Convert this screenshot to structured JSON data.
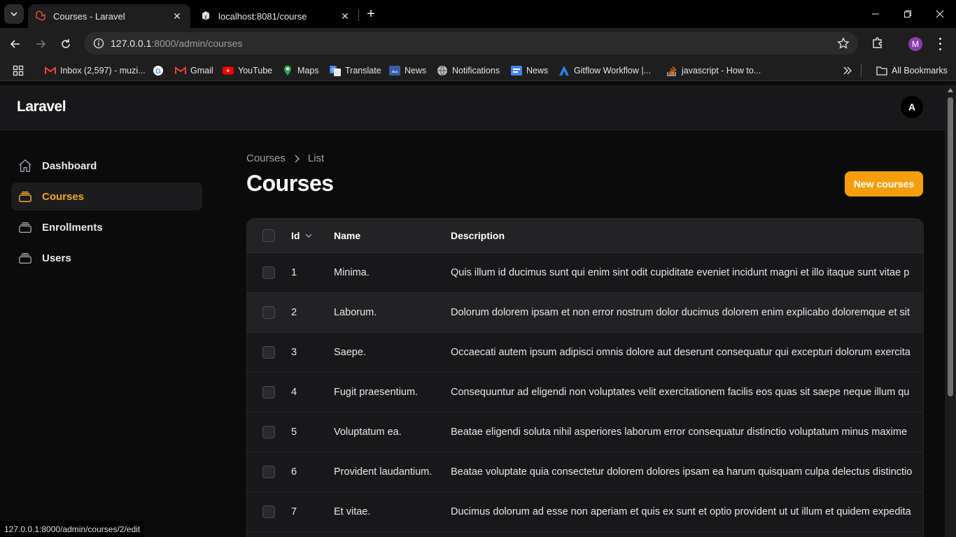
{
  "browser": {
    "tabs": [
      {
        "title": "Courses - Laravel",
        "active": true
      },
      {
        "title": "localhost:8081/course",
        "active": false
      }
    ],
    "url_host": "127.0.0.1",
    "url_rest": ":8000/admin/courses",
    "profile_initial": "M",
    "bookmarks": [
      {
        "label": "Inbox (2,597) - muzi...",
        "icon": "gmail-icon"
      },
      {
        "label": "",
        "icon": "google-icon"
      },
      {
        "label": "Gmail",
        "icon": "gmail-icon"
      },
      {
        "label": "YouTube",
        "icon": "youtube-icon"
      },
      {
        "label": "Maps",
        "icon": "maps-icon"
      },
      {
        "label": "Translate",
        "icon": "translate-icon"
      },
      {
        "label": "News",
        "icon": "news-icon"
      },
      {
        "label": "Notifications",
        "icon": "globe-icon"
      },
      {
        "label": "News",
        "icon": "google-news-icon"
      },
      {
        "label": "Gitflow Workflow |...",
        "icon": "atlassian-icon"
      },
      {
        "label": "javascript - How to...",
        "icon": "stackoverflow-icon"
      }
    ],
    "all_bookmarks": "All Bookmarks",
    "status_url": "127.0.0.1:8000/admin/courses/2/edit"
  },
  "app": {
    "brand": "Laravel",
    "user_initial": "A",
    "accent": "#f59e0b",
    "sidebar": [
      {
        "label": "Dashboard",
        "icon": "home-icon",
        "active": false
      },
      {
        "label": "Courses",
        "icon": "stack-icon",
        "active": true
      },
      {
        "label": "Enrollments",
        "icon": "stack-icon",
        "active": false
      },
      {
        "label": "Users",
        "icon": "stack-icon",
        "active": false
      }
    ],
    "breadcrumb": {
      "first": "Courses",
      "second": "List"
    },
    "page_title": "Courses",
    "new_button": "New courses",
    "table": {
      "headers": {
        "id": "Id",
        "name": "Name",
        "description": "Description"
      },
      "rows": [
        {
          "id": "1",
          "name": "Minima.",
          "description": "Quis illum id ducimus sunt qui enim sint odit cupiditate eveniet incidunt magni et illo itaque sunt vitae p"
        },
        {
          "id": "2",
          "name": "Laborum.",
          "description": "Dolorum dolorem ipsam et non error nostrum dolor ducimus dolorem enim explicabo doloremque et sit"
        },
        {
          "id": "3",
          "name": "Saepe.",
          "description": "Occaecati autem ipsum adipisci omnis dolore aut deserunt consequatur qui excepturi dolorum exercita"
        },
        {
          "id": "4",
          "name": "Fugit praesentium.",
          "description": "Consequuntur ad eligendi non voluptates velit exercitationem facilis eos quas sit saepe neque illum qu"
        },
        {
          "id": "5",
          "name": "Voluptatum ea.",
          "description": "Beatae eligendi soluta nihil asperiores laborum error consequatur distinctio voluptatum minus maxime"
        },
        {
          "id": "6",
          "name": "Provident laudantium.",
          "description": "Beatae voluptate quia consectetur dolorem dolores ipsam ea harum quisquam culpa delectus distinctio"
        },
        {
          "id": "7",
          "name": "Et vitae.",
          "description": "Ducimus dolorum ad esse non aperiam et quis ex sunt et optio provident ut ut illum et quidem expedita"
        }
      ]
    }
  }
}
